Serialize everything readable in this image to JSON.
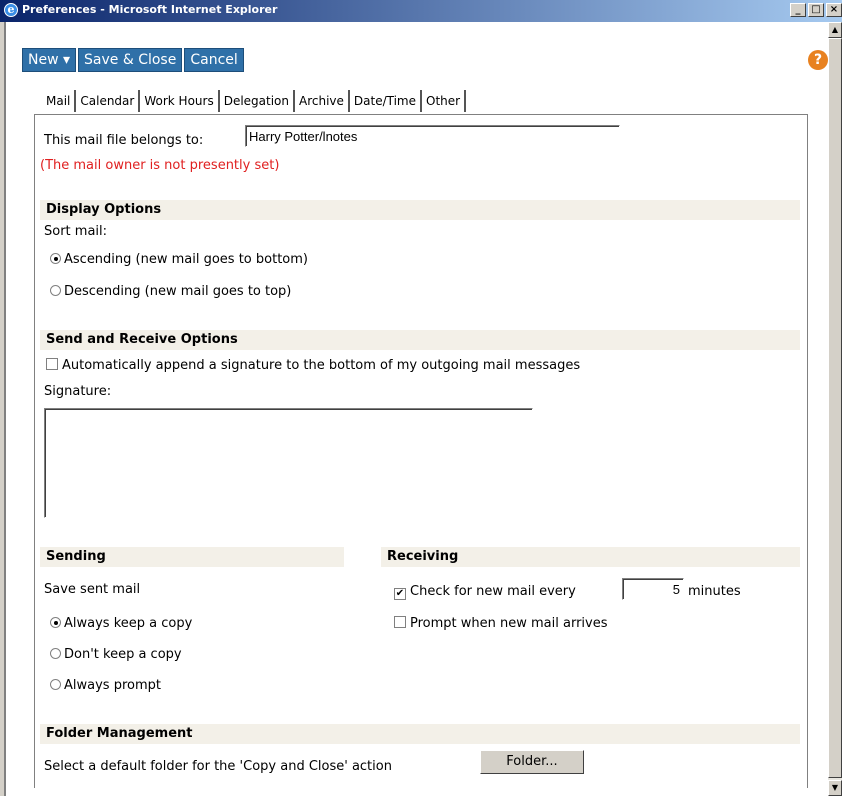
{
  "window": {
    "title": "Preferences - Microsoft Internet Explorer",
    "controls": [
      "_",
      "□",
      "×"
    ]
  },
  "toolbar": {
    "new_label": "New ▾",
    "save_close_label": "Save & Close",
    "cancel_label": "Cancel",
    "help_icon": "?"
  },
  "tabs": [
    "Mail",
    "Calendar",
    "Work Hours",
    "Delegation",
    "Archive",
    "Date/Time",
    "Other"
  ],
  "mail": {
    "owner_label": "This mail file belongs to:",
    "owner_value": "Harry Potter/lnotes",
    "owner_warning": "(The mail owner is not presently set)"
  },
  "display": {
    "heading": "Display Options",
    "sort_label": "Sort mail:",
    "options": [
      {
        "label": "Ascending (new mail goes to bottom)",
        "selected": true
      },
      {
        "label": "Descending (new mail goes to top)",
        "selected": false
      }
    ]
  },
  "send_receive": {
    "heading": "Send and Receive Options",
    "append_signature_label": "Automatically append a signature to the bottom of my outgoing mail messages",
    "append_signature_checked": false,
    "signature_label": "Signature:",
    "signature_value": ""
  },
  "sending": {
    "heading": "Sending",
    "save_label": "Save sent mail",
    "options": [
      {
        "label": "Always keep a copy",
        "selected": true
      },
      {
        "label": "Don't keep a copy",
        "selected": false
      },
      {
        "label": "Always prompt",
        "selected": false
      }
    ]
  },
  "receiving": {
    "heading": "Receiving",
    "check_label": "Check for new mail every",
    "check_checked": true,
    "check_value": "5",
    "check_unit": "minutes",
    "prompt_label": "Prompt when new mail arrives",
    "prompt_checked": false
  },
  "folder": {
    "heading": "Folder Management",
    "description": "Select a default folder for the 'Copy and Close' action",
    "button_label": "Folder..."
  },
  "colors": {
    "toolbar_button": "#2f70a8",
    "warning_text": "#e02020",
    "section_band": "#f3f0e8"
  }
}
